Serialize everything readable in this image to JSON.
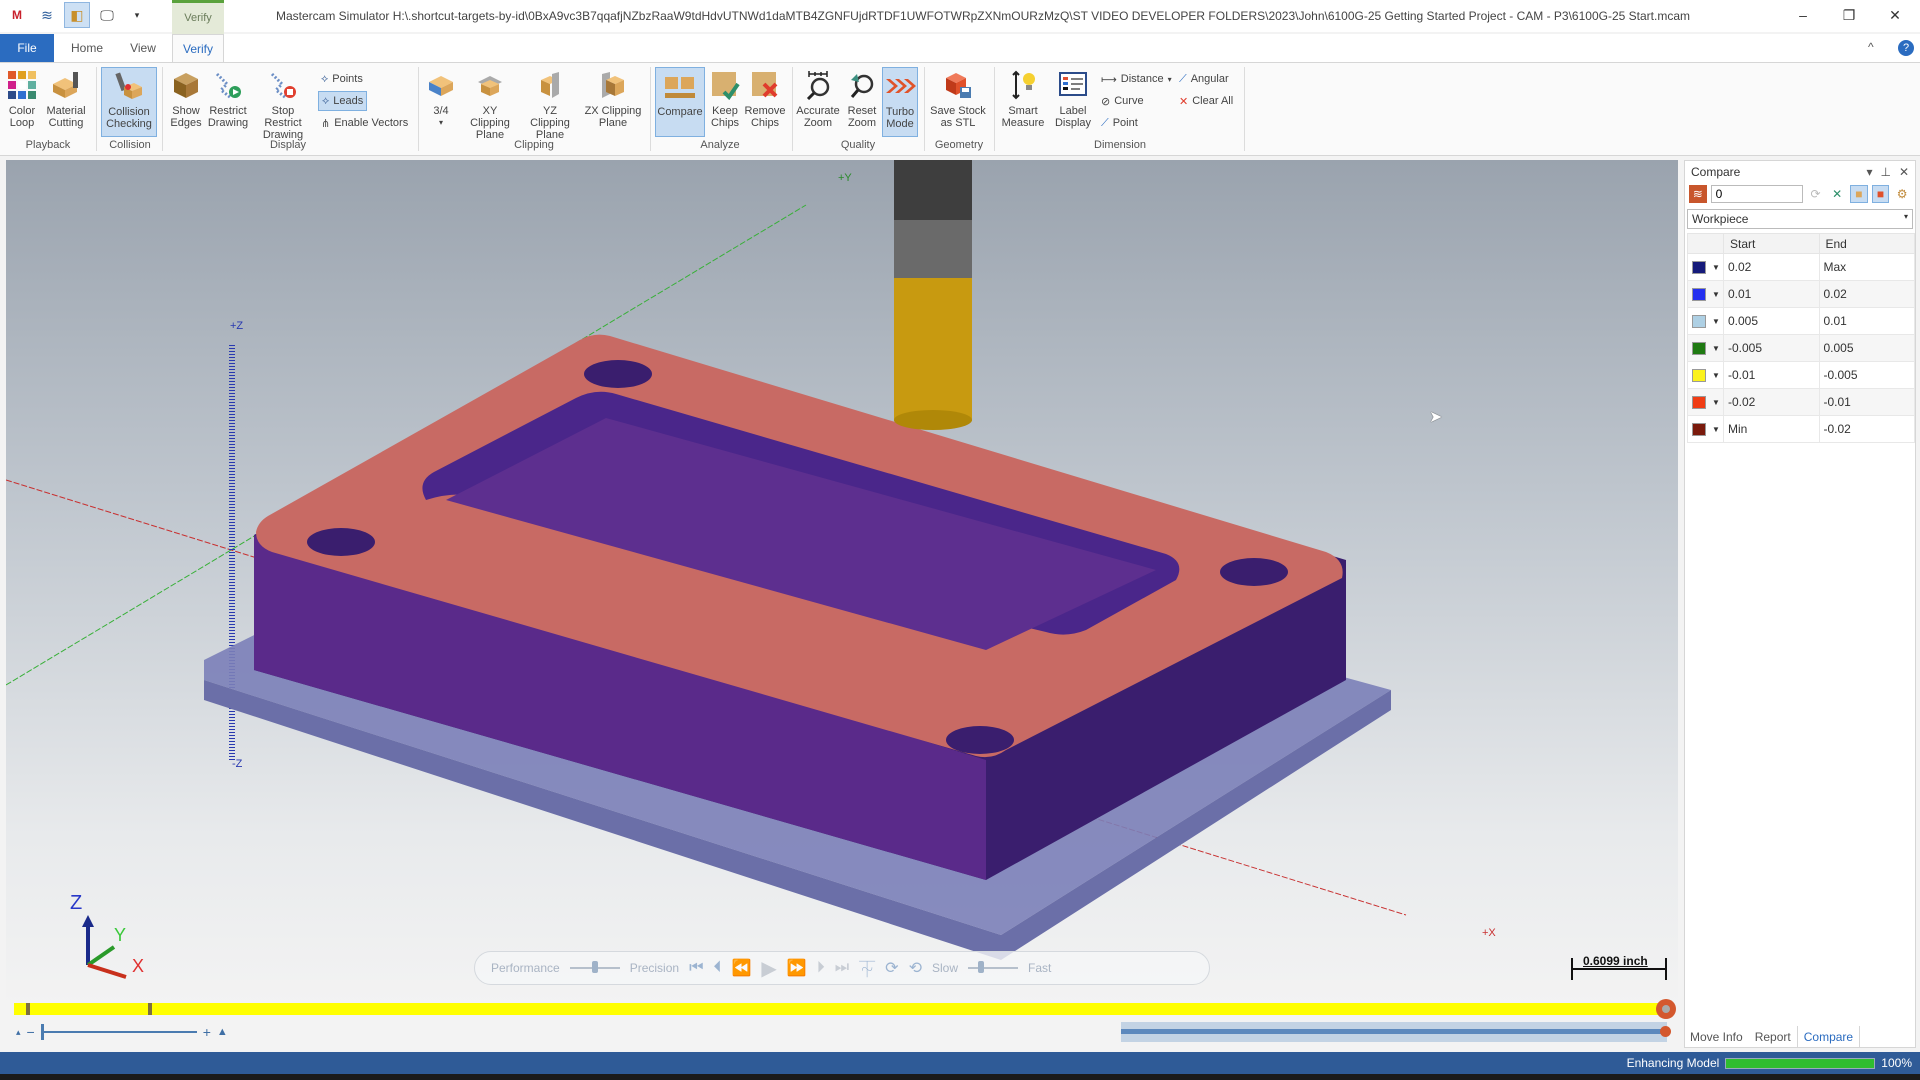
{
  "window": {
    "title": "Mastercam Simulator  H:\\.shortcut-targets-by-id\\0BxA9vc3B7qqafjNZbzRaaW9tdHdvUTNWd1daMTB4ZGNFUjdRTDF1UWFOTWRpZXNmOURzMzQ\\ST VIDEO DEVELOPER FOLDERS\\2023\\John\\6100G-25 Getting Started Project - CAM - P3\\6100G-25 Start.mcam",
    "context_tab": "Verify",
    "controls": {
      "minimize": "–",
      "restore": "❐",
      "close": "✕"
    }
  },
  "ribbon_tabs": [
    {
      "label": "File"
    },
    {
      "label": "Home"
    },
    {
      "label": "View"
    },
    {
      "label": "Verify",
      "active": true
    }
  ],
  "ribbon": {
    "playback": {
      "label": "Playback",
      "color_loop": "Color Loop",
      "material_cutting": "Material Cutting"
    },
    "collision": {
      "label": "Collision",
      "collision_checking": "Collision Checking"
    },
    "display": {
      "label": "Display",
      "show_edges": "Show Edges",
      "restrict_drawing": "Restrict Drawing",
      "stop_restrict_drawing": "Stop Restrict Drawing",
      "points": "Points",
      "leads": "Leads",
      "enable_vectors": "Enable Vectors"
    },
    "clipping": {
      "label": "Clipping",
      "three_quarter": "3/4",
      "xy": "XY Clipping Plane",
      "yz": "YZ Clipping Plane",
      "zx": "ZX Clipping Plane"
    },
    "analyze": {
      "label": "Analyze",
      "compare": "Compare",
      "keep_chips": "Keep Chips",
      "remove_chips": "Remove Chips"
    },
    "quality": {
      "label": "Quality",
      "accurate_zoom": "Accurate Zoom",
      "reset_zoom": "Reset Zoom",
      "turbo_mode": "Turbo Mode"
    },
    "geometry": {
      "label": "Geometry",
      "save_stock": "Save Stock as STL"
    },
    "dimension": {
      "label": "Dimension",
      "smart_measure": "Smart Measure",
      "label_display": "Label Display",
      "distance": "Distance",
      "curve": "Curve",
      "point": "Point",
      "angular": "Angular",
      "clear_all": "Clear All"
    }
  },
  "viewport": {
    "axes": {
      "plus_y": "+Y",
      "plus_z": "+Z",
      "minus_z": "-Z",
      "plus_x": "+X"
    },
    "triad": {
      "x": "X",
      "y": "Y",
      "z": "Z"
    },
    "scale_label": "0.6099 inch",
    "playback_bar": {
      "performance": "Performance",
      "precision": "Precision",
      "slow": "Slow",
      "fast": "Fast",
      "quality_slider": 0.5,
      "speed_slider": 0.25
    },
    "timeline_progress": 1.0,
    "zoom_slider": 0.0
  },
  "compare_panel": {
    "title": "Compare",
    "tolerance_value": "0",
    "target_select": "Workpiece",
    "columns": [
      "Start",
      "End"
    ],
    "rows": [
      {
        "color": "#151a7a",
        "start": "0.02",
        "end": "Max"
      },
      {
        "color": "#2430f0",
        "start": "0.01",
        "end": "0.02"
      },
      {
        "color": "#aed0e4",
        "start": "0.005",
        "end": "0.01"
      },
      {
        "color": "#1f7a12",
        "start": "-0.005",
        "end": "0.005"
      },
      {
        "color": "#fbf21c",
        "start": "-0.01",
        "end": "-0.005"
      },
      {
        "color": "#f03c14",
        "start": "-0.02",
        "end": "-0.01"
      },
      {
        "color": "#7a1a0c",
        "start": "Min",
        "end": "-0.02"
      }
    ],
    "tabs": [
      {
        "label": "Move Info"
      },
      {
        "label": "Report"
      },
      {
        "label": "Compare",
        "active": true
      }
    ]
  },
  "status": {
    "text": "Enhancing Model",
    "progress": 1.0,
    "percent": "100%"
  }
}
